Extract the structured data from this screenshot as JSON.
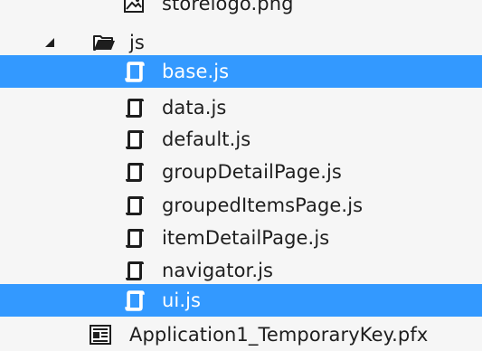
{
  "tree": {
    "partial_top": {
      "label": "storelogo.png",
      "icon": "image-file-icon"
    },
    "folder": {
      "label": "js",
      "icon": "folder-open-icon",
      "expanded": true
    },
    "files": [
      {
        "label": "base.js",
        "icon": "script-file-icon",
        "selected": true
      },
      {
        "label": "data.js",
        "icon": "script-file-icon",
        "selected": false
      },
      {
        "label": "default.js",
        "icon": "script-file-icon",
        "selected": false
      },
      {
        "label": "groupDetailPage.js",
        "icon": "script-file-icon",
        "selected": false
      },
      {
        "label": "groupedItemsPage.js",
        "icon": "script-file-icon",
        "selected": false
      },
      {
        "label": "itemDetailPage.js",
        "icon": "script-file-icon",
        "selected": false
      },
      {
        "label": "navigator.js",
        "icon": "script-file-icon",
        "selected": false
      },
      {
        "label": "ui.js",
        "icon": "script-file-icon",
        "selected": true
      }
    ],
    "partial_bottom": {
      "label": "Application1_TemporaryKey.pfx",
      "icon": "certificate-file-icon"
    }
  },
  "colors": {
    "background": "#f6f6f6",
    "selection": "#3399ff",
    "selection_text": "#ffffff",
    "text": "#1e1e1e"
  }
}
